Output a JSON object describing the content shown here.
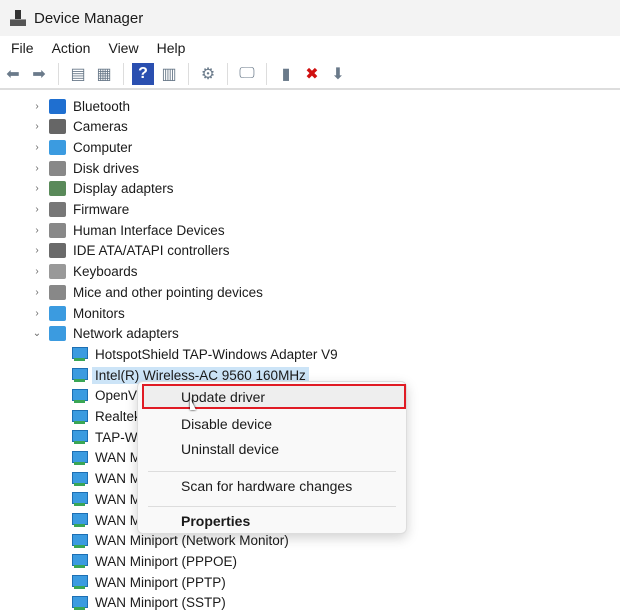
{
  "window": {
    "title": "Device Manager"
  },
  "menubar": [
    "File",
    "Action",
    "View",
    "Help"
  ],
  "toolbar": [
    {
      "icon": "back-arrow-icon",
      "glyph": "⬅"
    },
    {
      "icon": "forward-arrow-icon",
      "glyph": "➡"
    },
    {
      "icon": "show-hide-console-tree-icon",
      "glyph": "▤"
    },
    {
      "icon": "properties-sheet-icon",
      "glyph": "▦"
    },
    {
      "icon": "help-icon",
      "glyph": "?"
    },
    {
      "icon": "action-pane-icon",
      "glyph": "▥"
    },
    {
      "icon": "update-driver-icon",
      "glyph": "⚙"
    },
    {
      "icon": "scan-hardware-icon",
      "glyph": "🖵"
    },
    {
      "icon": "enable-device-icon",
      "glyph": "▮"
    },
    {
      "icon": "uninstall-icon",
      "glyph": "✖"
    },
    {
      "icon": "disable-device-icon",
      "glyph": "⬇"
    }
  ],
  "categories": [
    {
      "label": "Bluetooth",
      "color": "#1f6fd0"
    },
    {
      "label": "Cameras",
      "color": "#666"
    },
    {
      "label": "Computer",
      "color": "#3b9be0"
    },
    {
      "label": "Disk drives",
      "color": "#888"
    },
    {
      "label": "Display adapters",
      "color": "#5a8a5a"
    },
    {
      "label": "Firmware",
      "color": "#777"
    },
    {
      "label": "Human Interface Devices",
      "color": "#888"
    },
    {
      "label": "IDE ATA/ATAPI controllers",
      "color": "#6a6a6a"
    },
    {
      "label": "Keyboards",
      "color": "#999"
    },
    {
      "label": "Mice and other pointing devices",
      "color": "#888"
    },
    {
      "label": "Monitors",
      "color": "#3b9be0"
    },
    {
      "label": "Network adapters",
      "color": "#3b9be0"
    }
  ],
  "network_adapters": [
    "HotspotShield TAP-Windows Adapter V9",
    "Intel(R) Wireless-AC 9560 160MHz",
    "OpenV",
    "Realtek",
    "TAP-Wi",
    "WAN M",
    "WAN M",
    "WAN M",
    "WAN M",
    "WAN Miniport (Network Monitor)",
    "WAN Miniport (PPPOE)",
    "WAN Miniport (PPTP)",
    "WAN Miniport (SSTP)"
  ],
  "selected_index": 1,
  "context_menu": {
    "update": "Update driver",
    "disable": "Disable device",
    "uninstall": "Uninstall device",
    "scan": "Scan for hardware changes",
    "properties": "Properties"
  },
  "highlight_color": "#e01b24"
}
